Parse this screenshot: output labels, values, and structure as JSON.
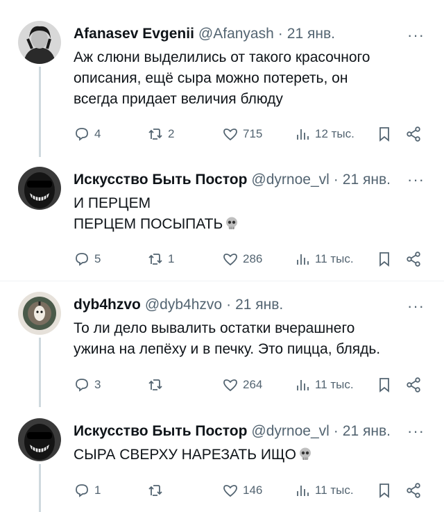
{
  "tweets": [
    {
      "name": "Afanasev Evgenii",
      "handle": "@Afanyash",
      "dot": "·",
      "time": "21 янв.",
      "text_lines": [
        "Аж слюни выделились от такого красочного",
        "описания, ещё сыра можно потереть, он",
        "всегда придает величия блюду"
      ],
      "replies": "4",
      "reposts": "2",
      "likes": "715",
      "views": "12 тыс."
    },
    {
      "name": "Искусство Быть Постор",
      "handle": "@dyrnoe_vl",
      "dot": "·",
      "time": "21 янв.",
      "text_lines": [
        "И ПЕРЦЕМ",
        "ПЕРЦЕМ ПОСЫПАТЬ"
      ],
      "replies": "5",
      "reposts": "1",
      "likes": "286",
      "views": "11 тыс."
    },
    {
      "name": "dyb4hzvo",
      "handle": "@dyb4hzvo",
      "dot": "·",
      "time": "21 янв.",
      "text_lines": [
        "То ли дело вывалить остатки вчерашнего",
        "ужина на лепёху и в печку. Это пицца, блядь."
      ],
      "replies": "3",
      "reposts": "",
      "likes": "264",
      "views": "11 тыс."
    },
    {
      "name": "Искусство Быть Постор",
      "handle": "@dyrnoe_vl",
      "dot": "·",
      "time": "21 янв.",
      "text_lines": [
        "СЫРА СВЕРХУ НАРЕЗАТЬ ИЩО"
      ],
      "replies": "1",
      "reposts": "",
      "likes": "146",
      "views": "11 тыс."
    }
  ],
  "more_label": "···",
  "icons": [
    "reply-icon",
    "repost-icon",
    "like-icon",
    "views-icon",
    "bookmark-icon",
    "share-icon",
    "skull-emoji"
  ]
}
